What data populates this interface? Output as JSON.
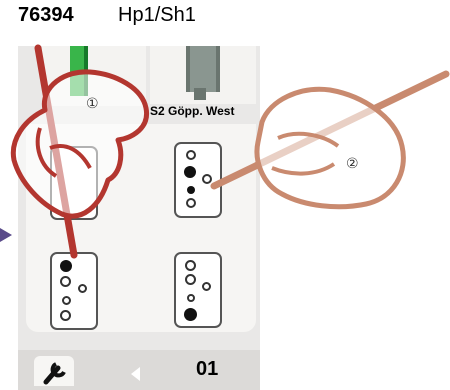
{
  "header": {
    "article_number": "76394",
    "signal_name": "Hp1/Sh1"
  },
  "device": {
    "location_label": "S2 Göpp. West",
    "page_number": "01",
    "settings_icon": "wrench-icon",
    "prev_icon": "triangle-left-icon"
  },
  "annotations": {
    "step1": "①",
    "step2": "②"
  },
  "aspects": [
    {
      "name": "aspect-top-left",
      "lamps": [
        "?",
        "?",
        "?",
        "?",
        "?"
      ]
    },
    {
      "name": "aspect-top-right",
      "lamps": [
        "off",
        "on",
        "off",
        "on",
        "off"
      ]
    },
    {
      "name": "aspect-bottom-left",
      "lamps": [
        "on",
        "off",
        "off",
        "off",
        "off"
      ]
    },
    {
      "name": "aspect-bottom-right",
      "lamps": [
        "off",
        "off",
        "off",
        "off",
        "on"
      ]
    }
  ],
  "colors": {
    "pen_dark_red": "#b3362f",
    "pen_light": "#c98a6f",
    "signal_green": "#39b54a",
    "signal_grey": "#8a9690"
  }
}
